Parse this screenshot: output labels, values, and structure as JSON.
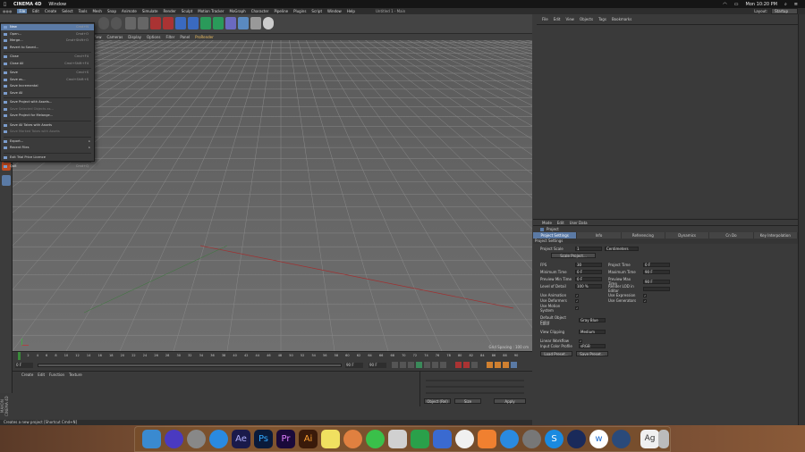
{
  "macbar": {
    "app": "CINEMA 4D",
    "menu": "Window",
    "time": "Mon 10:20 PM"
  },
  "window": {
    "title": "Untitled 1 - Main"
  },
  "menubar": {
    "items": [
      "File",
      "Edit",
      "Create",
      "Select",
      "Tools",
      "Mesh",
      "Snap",
      "Animate",
      "Simulate",
      "Render",
      "Sculpt",
      "Motion Tracker",
      "MoGraph",
      "Character",
      "Pipeline",
      "Plugins",
      "Script",
      "Window",
      "Help"
    ],
    "layout_label": "Layout:",
    "layout_value": "Startup"
  },
  "filemenu": {
    "items": [
      {
        "label": "New",
        "shortcut": "Cmd+N",
        "state": "hl"
      },
      {
        "label": "Open...",
        "shortcut": "Cmd+O"
      },
      {
        "label": "Merge...",
        "shortcut": "Cmd+Shift+O"
      },
      {
        "label": "Revert to Saved...",
        "shortcut": ""
      },
      {
        "label": "Close",
        "shortcut": "Cmd+F4"
      },
      {
        "label": "Close All",
        "shortcut": "Cmd+Shift+F4"
      },
      {
        "label": "Save",
        "shortcut": "Cmd+S"
      },
      {
        "label": "Save as...",
        "shortcut": "Cmd+Shift+S"
      },
      {
        "label": "Save Incremental",
        "shortcut": ""
      },
      {
        "label": "Save All",
        "shortcut": ""
      },
      {
        "label": "Save Project with Assets...",
        "shortcut": ""
      },
      {
        "label": "Save Selected Objects as...",
        "shortcut": "",
        "state": "dim"
      },
      {
        "label": "Save Project for Melange...",
        "shortcut": ""
      },
      {
        "label": "Save All Takes with Assets",
        "shortcut": ""
      },
      {
        "label": "Save Marked Takes with Assets",
        "shortcut": "",
        "state": "dim"
      },
      {
        "label": "Export...",
        "shortcut": "",
        "arrow": "▸"
      },
      {
        "label": "Recent Files",
        "shortcut": "",
        "arrow": "▸"
      },
      {
        "label": "Exit Trial Price Licence",
        "shortcut": ""
      },
      {
        "label": "Quit",
        "shortcut": "Cmd+Q"
      }
    ]
  },
  "viewport": {
    "menu": [
      "View",
      "Cameras",
      "Display",
      "Options",
      "Filter",
      "Panel",
      "ProRender"
    ],
    "label": "Grid Spacing : 100 cm"
  },
  "timeline": {
    "ticks": [
      "0",
      "2",
      "4",
      "6",
      "8",
      "10",
      "12",
      "14",
      "16",
      "18",
      "20",
      "22",
      "24",
      "26",
      "28",
      "30",
      "32",
      "34",
      "36",
      "38",
      "40",
      "42",
      "44",
      "46",
      "48",
      "50",
      "52",
      "54",
      "56",
      "58",
      "60",
      "62",
      "64",
      "66",
      "68",
      "70",
      "72",
      "74",
      "76",
      "78",
      "80",
      "82",
      "84",
      "86",
      "88",
      "90"
    ],
    "frame": "0 F",
    "start": "0 F",
    "end": "90 F",
    "current": "90 F"
  },
  "material": {
    "menu": [
      "Create",
      "Edit",
      "Function",
      "Texture"
    ]
  },
  "coords": {
    "apply": "Apply",
    "mode1": "Object (Rel)",
    "mode2": "Size"
  },
  "status": {
    "text": "Creates a new project [Shortcut Cmd+N]"
  },
  "maxon": {
    "text": "MAXON CINEMA 4D"
  },
  "objmgr": {
    "menu": [
      "File",
      "Edit",
      "View",
      "Objects",
      "Tags",
      "Bookmarks"
    ]
  },
  "attr": {
    "menu": [
      "Mode",
      "Edit",
      "User Data"
    ],
    "mode_label": "Project",
    "tabs": [
      "Project Settings",
      "Info",
      "Referencing",
      "Dynamics",
      "Cn Do",
      "Key Interpolation"
    ],
    "section": "Project Settings",
    "project_scale_label": "Project Scale",
    "project_scale_value": "1",
    "project_scale_unit": "Centimeters",
    "scale_btn": "Scale Project...",
    "fields_left": [
      {
        "label": "FPS",
        "value": "30"
      },
      {
        "label": "Minimum Time",
        "value": "0 F"
      },
      {
        "label": "Preview Min Time",
        "value": "0 F"
      },
      {
        "label": "Level of Detail",
        "value": "100 %"
      }
    ],
    "fields_right": [
      {
        "label": "Project Time",
        "value": "0 F"
      },
      {
        "label": "Maximum Time",
        "value": "90 F"
      },
      {
        "label": "Preview Max Time",
        "value": "90 F"
      },
      {
        "label": "Render LOD in Editor",
        "value": ""
      }
    ],
    "checks_left": [
      "Use Animation",
      "Use Deformers",
      "Use Motion System"
    ],
    "checks_right": [
      "Use Expression",
      "Use Generators"
    ],
    "default_color_label": "Default Object Color",
    "default_color_value": "Gray Blue",
    "color_label": "Color",
    "view_clipping_label": "View Clipping",
    "view_clipping_value": "Medium",
    "linear_workflow_label": "Linear Workflow",
    "input_color_label": "Input Color Profile",
    "input_color_value": "sRGB",
    "btn_load": "Load Preset...",
    "btn_save": "Save Preset..."
  },
  "colors": {
    "accent": "#5b7aa5",
    "highlight": "#f0c060"
  }
}
